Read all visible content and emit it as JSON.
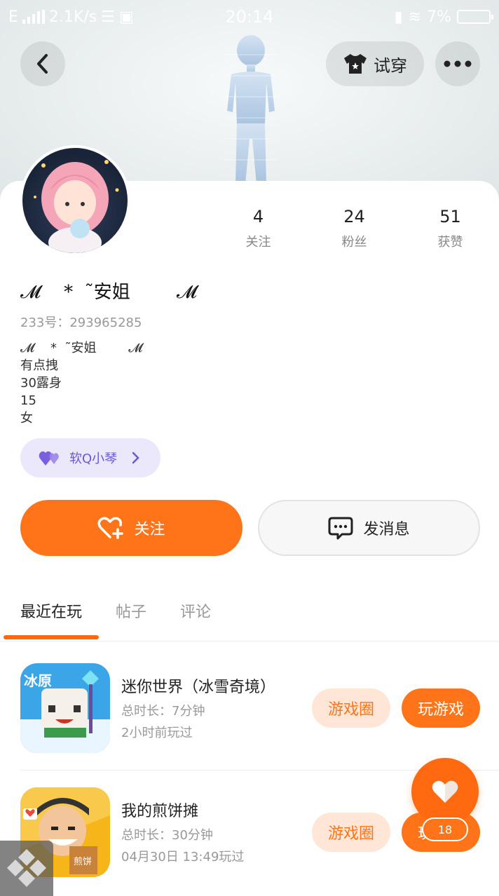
{
  "status_bar": {
    "network": "E",
    "speed": "2.1K/s",
    "time": "20:14",
    "battery": "7%"
  },
  "header": {
    "try_on_label": "试穿"
  },
  "profile": {
    "stats": [
      {
        "value": "4",
        "label": "关注"
      },
      {
        "value": "24",
        "label": "粉丝"
      },
      {
        "value": "51",
        "label": "获赞"
      }
    ],
    "nickname": "𝓜    *  ˜安姐        𝓜",
    "uid": "233号：293965285",
    "bio": "𝓜    *  ˜安姐        𝓜\n有点拽\n30露身\n15\n女",
    "badge_label": "软Q小琴"
  },
  "actions": {
    "follow_label": "关注",
    "message_label": "发消息"
  },
  "tabs": [
    {
      "label": "最近在玩"
    },
    {
      "label": "帖子"
    },
    {
      "label": "评论"
    }
  ],
  "games": [
    {
      "title": "迷你世界（冰雪奇境）",
      "duration": "总时长：7分钟",
      "last_played": "2小时前玩过",
      "circle_label": "游戏圈",
      "play_label": "玩游戏",
      "icon_text": "冰原"
    },
    {
      "title": "我的煎饼摊",
      "duration": "总时长：30分钟",
      "last_played": "04月30日 13:49玩过",
      "circle_label": "游戏圈",
      "play_label": "玩游戏",
      "icon_text": "煎饼"
    }
  ],
  "fab": {
    "count": "18"
  },
  "colors": {
    "accent": "#ff7418",
    "badge_bg": "#ece8fb",
    "badge_text": "#6b57d6"
  }
}
